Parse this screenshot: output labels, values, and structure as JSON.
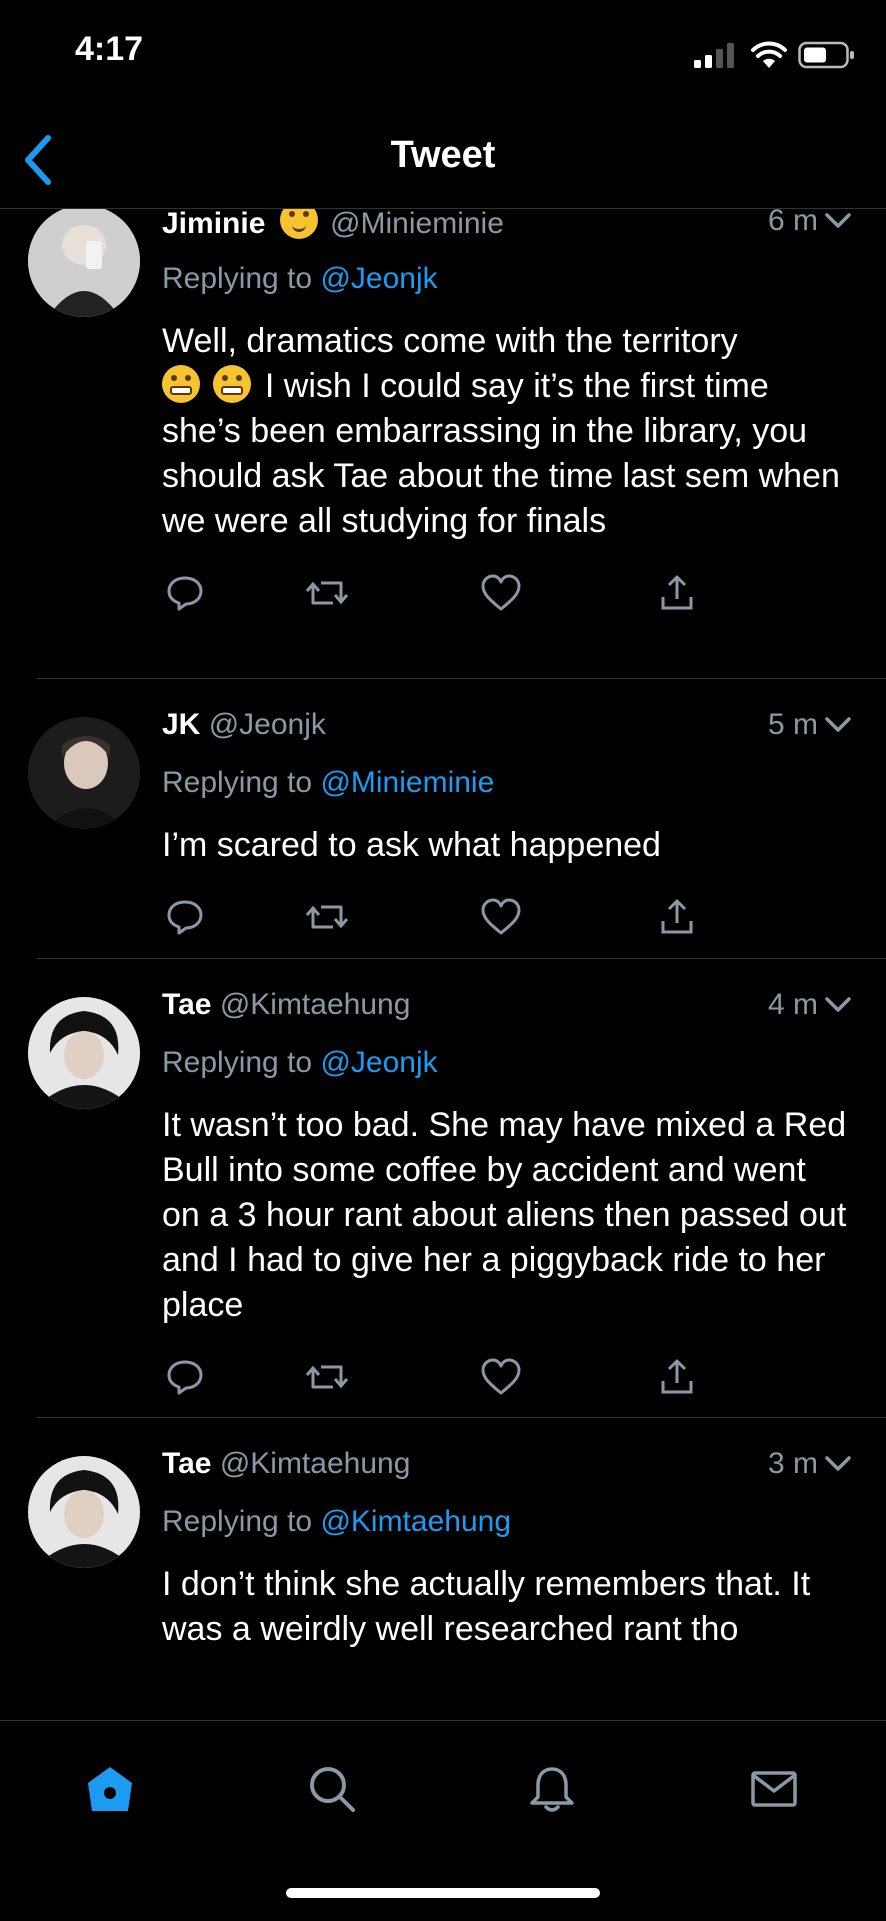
{
  "status_bar": {
    "time": "4:17"
  },
  "header": {
    "title": "Tweet"
  },
  "tweets": [
    {
      "name": "Jiminie",
      "handle": "@Minieminie",
      "time": "6 m",
      "replying_prefix": "Replying to",
      "replying_to": "@Jeonjk",
      "body_line1": "Well, dramatics come with the territory",
      "body_rest": "I wish I could say it’s the first time she’s been embarrassing in the library, you should ask Tae about the time last sem when we were all studying for finals",
      "avatar_color": "#9a9a9a"
    },
    {
      "name": "JK",
      "handle": "@Jeonjk",
      "time": "5 m",
      "replying_prefix": "Replying to",
      "replying_to": "@Minieminie",
      "body": "I’m scared to ask what happened",
      "avatar_color": "#2a2a2a"
    },
    {
      "name": "Tae",
      "handle": "@Kimtaehung",
      "time": "4 m",
      "replying_prefix": "Replying to",
      "replying_to": "@Jeonjk",
      "body": "It wasn’t too bad. She may have mixed a Red Bull into some coffee by accident and went on a 3 hour rant about aliens then passed out and I had to give her a piggyback ride to her place",
      "avatar_color": "#3a3a3a"
    },
    {
      "name": "Tae",
      "handle": "@Kimtaehung",
      "time": "3 m",
      "replying_prefix": "Replying to",
      "replying_to": "@Kimtaehung",
      "body": "I don’t think she actually remembers that. It was a weirdly well researched rant tho",
      "avatar_color": "#3a3a3a"
    }
  ],
  "colors": {
    "accent": "#1d9bf0",
    "secondary_text": "#8b98a5",
    "divider": "#2f3336",
    "background": "#000000"
  },
  "tabs": [
    {
      "icon": "home-icon",
      "active": true
    },
    {
      "icon": "search-icon",
      "active": false
    },
    {
      "icon": "bell-icon",
      "active": false
    },
    {
      "icon": "mail-icon",
      "active": false
    }
  ]
}
